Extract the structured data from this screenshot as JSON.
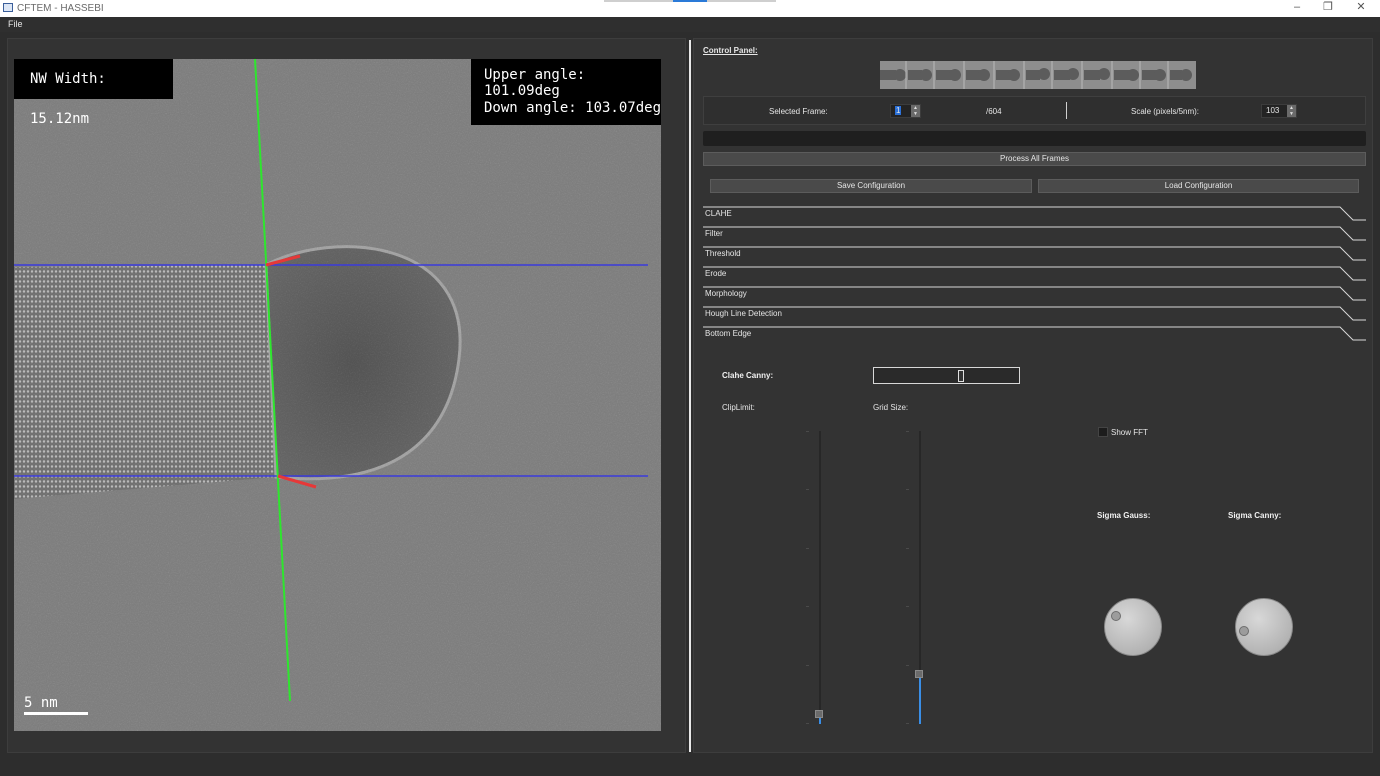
{
  "window": {
    "title": "CFTEM - HASSEBI",
    "controls": {
      "minimize": "–",
      "maximize": "❐",
      "close": "✕"
    }
  },
  "menu": {
    "file": "File"
  },
  "image_view": {
    "overlays": {
      "width_label": "NW Width: 15.12nm",
      "upper_angle": "Upper angle: 101.09deg",
      "down_angle": "Down angle: 103.07deg",
      "scale_bar": "5 nm"
    },
    "line_colors": {
      "center": "#2ee62e",
      "edges": "#3b3bdc",
      "angles": "#e63838"
    }
  },
  "control_panel": {
    "title": "Control Panel:",
    "selected_frame_label": "Selected Frame:",
    "selected_frame_value": "1",
    "frame_total": "/604",
    "scale_label": "Scale (pixels/5nm):",
    "scale_value": "103",
    "process_button": "Process All Frames",
    "save_button": "Save Configuration",
    "load_button": "Load Configuration",
    "sections": [
      "CLAHE",
      "Filter",
      "Threshold",
      "Erode",
      "Morphology",
      "Hough Line Detection",
      "Bottom Edge"
    ],
    "clahe_title": "Clahe Canny:",
    "clip_limit_label": "ClipLimit:",
    "grid_size_label": "Grid Size:",
    "clip_limit_level": 0.02,
    "grid_size_level": 0.16,
    "show_fft_label": "Show FFT",
    "show_fft_checked": false,
    "sigma_gauss_label": "Sigma Gauss:",
    "sigma_canny_label": "Sigma Canny:",
    "accent_color": "#3a8ee6"
  }
}
